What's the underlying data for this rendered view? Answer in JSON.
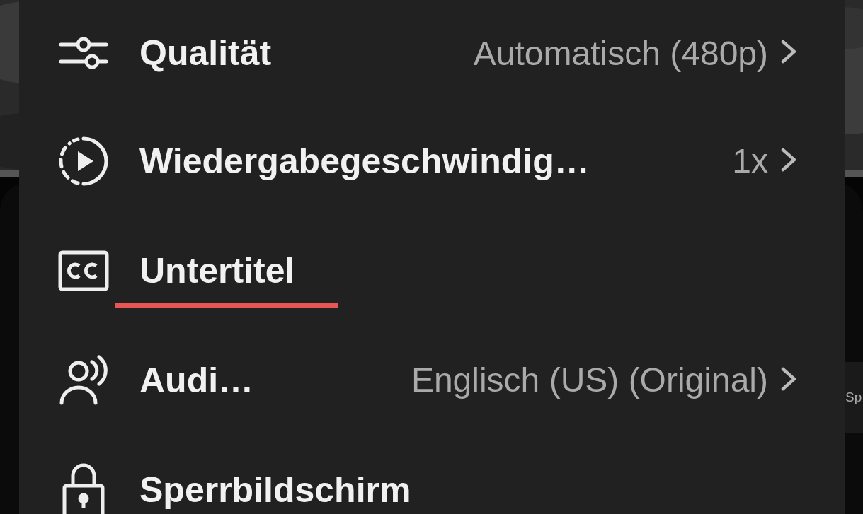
{
  "backdrop": {
    "chip_text": "Sp"
  },
  "menu": {
    "items": [
      {
        "kind": "quality",
        "label": "Qualität",
        "value": "Automatisch (480p)",
        "submenu": true,
        "underlined": false
      },
      {
        "kind": "speed",
        "label": "Wiedergabegeschwindig…",
        "value": "1x",
        "submenu": true,
        "underlined": false
      },
      {
        "kind": "captions",
        "label": "Untertitel",
        "submenu": false,
        "underlined": true
      },
      {
        "kind": "audio",
        "label": "Audi…",
        "value": "Englisch (US) (Original)",
        "submenu": true,
        "underlined": false
      },
      {
        "kind": "lock",
        "label": "Sperrbildschirm",
        "submenu": false,
        "underlined": false
      }
    ]
  }
}
